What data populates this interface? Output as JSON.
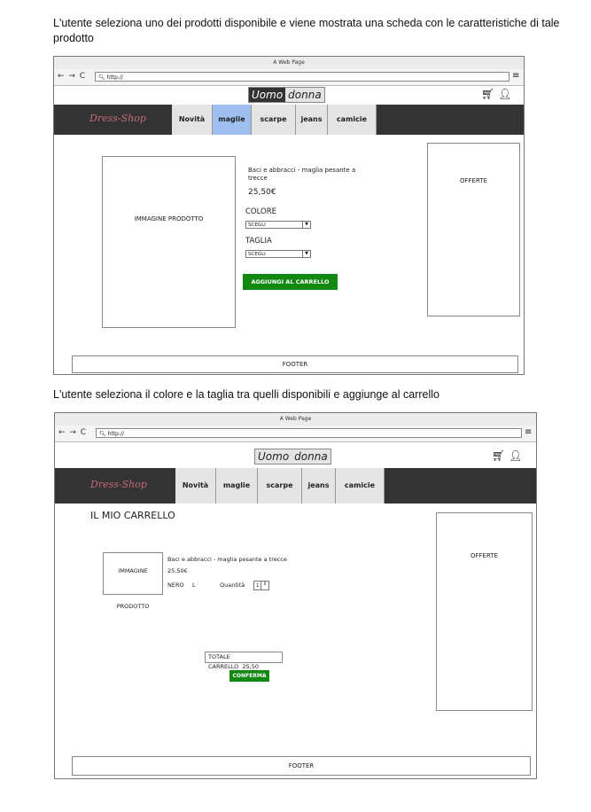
{
  "captions": {
    "first": "L'utente seleziona uno dei prodotti disponibile e viene mostrata una scheda con le caratteristiche di tale prodotto",
    "second": "L'utente seleziona il colore e la taglia tra quelli disponibili e aggiunge al carrello"
  },
  "browser": {
    "title": "A Web Page",
    "url": "http://",
    "nav_arrows": "← → C",
    "menu_icon": "hamburger-icon"
  },
  "header": {
    "switch_uomo": "Uomo",
    "switch_donna": "donna",
    "cart_icon": "cart-icon",
    "user_icon": "user-icon"
  },
  "nav": {
    "logo": "Dress-Shop",
    "items": [
      "Novità",
      "maglie",
      "scarpe",
      "jeans",
      "camicie"
    ],
    "active_index_mock1": 1,
    "active_color": "#9ebff0"
  },
  "product_page": {
    "image_label": "IMMAGINE PRODOTTO",
    "product_name": "Baci e abbracci - maglia pesante a trecce",
    "price": "25,50€",
    "color_label": "COLORE",
    "color_select": "SCEGLI",
    "size_label": "TAGLIA",
    "size_select": "SCEGLI",
    "add_to_cart": "AGGIUNGI AL CARRELLO",
    "offers": "OFFERTE",
    "footer": "FOOTER"
  },
  "cart_page": {
    "title": "IL MIO CARRELLO",
    "image_label": "IMMAGINE PRODOTTO",
    "product_name": "Baci e abbracci - maglia pesante a trecce",
    "price": "25,50€",
    "color": "NERO",
    "size": "L",
    "quantity_label": "Quantità",
    "quantity_value": "1",
    "total_label": "TOTALE CARRELLO",
    "total_value": "25,50",
    "confirm": "CONFERMA",
    "offers": "OFFERTE",
    "footer": "FOOTER"
  },
  "colors": {
    "navbar": "#333333",
    "button_green": "#118811"
  }
}
